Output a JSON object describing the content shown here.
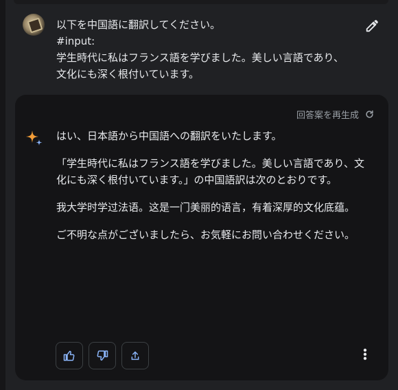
{
  "user_message": {
    "prompt": "以下を中国語に翻訳してください。\n#input:\n学生時代に私はフランス語を学びました。美しい言語であり、文化にも深く根付いています。"
  },
  "response": {
    "regenerate_label": "回答案を再生成",
    "paragraphs": [
      "はい、日本語から中国語への翻訳をいたします。",
      "「学生時代に私はフランス語を学びました。美しい言語であり、文化にも深く根付いています。」の中国語訳は次のとおりです。",
      "我大学时学过法语。这是一门美丽的语言，有着深厚的文化底蕴。",
      "ご不明な点がございましたら、お気軽にお問い合わせください。"
    ]
  },
  "icons": {
    "avatar": "user-avatar",
    "edit": "pencil-icon",
    "regenerate": "refresh-icon",
    "model": "sparkle-icon",
    "like": "thumbs-up-icon",
    "dislike": "thumbs-down-icon",
    "share": "share-icon",
    "more": "more-vert-icon"
  },
  "colors": {
    "background": "#202124",
    "card": "#141416",
    "text": "#e8eaed",
    "muted": "#9aa0a6",
    "sparkle_orange": "#f29d38",
    "sparkle_blue": "#8ab4f8"
  }
}
